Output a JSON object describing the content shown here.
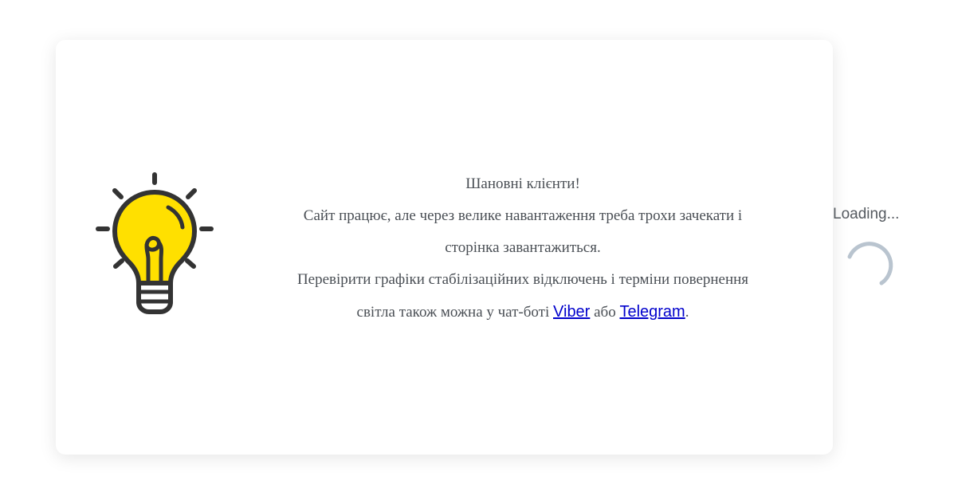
{
  "notice": {
    "greeting": "Шановні клієнти!",
    "line1": "Сайт працює, але через велике навантаження треба трохи зачекати і",
    "line2": "сторінка завантажиться.",
    "line3": "Перевірити графіки стабілізаційних відключень і терміни повернення",
    "line4_prefix": "світла також можна у чат-боті ",
    "viber_link": "Viber",
    "connector": " або ",
    "telegram_link": "Telegram",
    "line4_suffix": "."
  },
  "loader": {
    "label": "Loading..."
  },
  "icons": {
    "illustration": "lightbulb-icon",
    "spinner": "loading-spinner-icon"
  },
  "colors": {
    "bulb_fill": "#FFE000",
    "outline": "#333333",
    "text": "#4a4f55",
    "link": "#0000cc",
    "spinner": "#b9c4cf"
  }
}
